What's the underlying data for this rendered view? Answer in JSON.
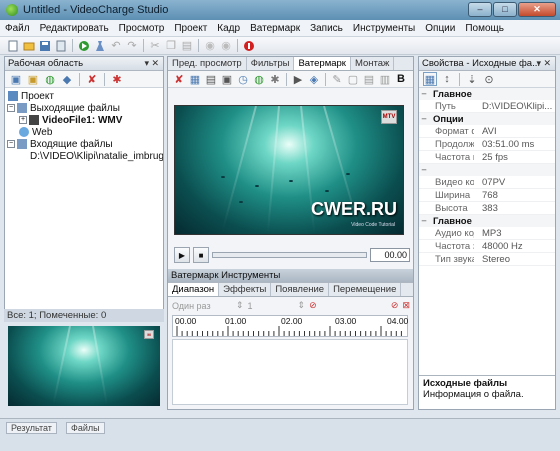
{
  "window": {
    "title": "Untitled - VideoCharge Studio"
  },
  "menu": [
    "Файл",
    "Редактировать",
    "Просмотр",
    "Проект",
    "Кадр",
    "Ватермарк",
    "Запись",
    "Инструменты",
    "Опции",
    "Помощь"
  ],
  "workspace": {
    "title": "Рабочая область",
    "tree": {
      "project": "Проект",
      "output": "Выходящие файлы",
      "video_file": "VideoFile1: WMV",
      "web": "Web",
      "input": "Входящие файлы",
      "input_file": "D:\\VIDEO\\Klipi\\natalie_imbruglia"
    },
    "status": "Все: 1; Помеченные: 0"
  },
  "center": {
    "tabs": [
      "Пред. просмотр",
      "Фильтры",
      "Ватермарк",
      "Монтаж"
    ],
    "active_tab": "Ватермарк",
    "watermark_text": "CWER.RU",
    "watermark_sub": "Video Code Tutorial",
    "time": "00.00",
    "instruments_title": "Ватермарк Инструменты",
    "subtabs": [
      "Диапазон",
      "Эффекты",
      "Появление",
      "Перемещение"
    ],
    "mode": "Один раз",
    "spinval": "1",
    "ruler_labels": [
      "00.00",
      "01.00",
      "02.00",
      "03.00",
      "04.00"
    ]
  },
  "properties": {
    "title": "Свойства - Исходные фа...",
    "sections": [
      {
        "name": "Главное",
        "rows": [
          {
            "k": "Путь",
            "v": "D:\\VIDEO\\Klipi..."
          }
        ]
      },
      {
        "name": "Опции",
        "rows": [
          {
            "k": "Формат файл",
            "v": "AVI"
          },
          {
            "k": "Продолжител",
            "v": "03:51.00 ms"
          },
          {
            "k": "Частота кадрс",
            "v": "25 fps"
          }
        ]
      },
      {
        "name": "",
        "rows": [
          {
            "k": "Видео кодек",
            "v": "07PV"
          },
          {
            "k": "Ширина",
            "v": "768"
          },
          {
            "k": "Высота",
            "v": "383"
          }
        ]
      },
      {
        "name": "Главное",
        "rows": [
          {
            "k": "Аудио кодек",
            "v": "MP3"
          },
          {
            "k": "Частота звука",
            "v": "48000 Hz"
          },
          {
            "k": "Тип звука",
            "v": "Stereo"
          }
        ]
      }
    ],
    "desc_title": "Исходные файлы",
    "desc_text": "Информация о файла."
  },
  "bottom_tabs": [
    "Результат",
    "Файлы"
  ],
  "colors": {
    "accent": "#3a6e9c",
    "record": "#d21f1f",
    "go": "#2f9a2f"
  }
}
